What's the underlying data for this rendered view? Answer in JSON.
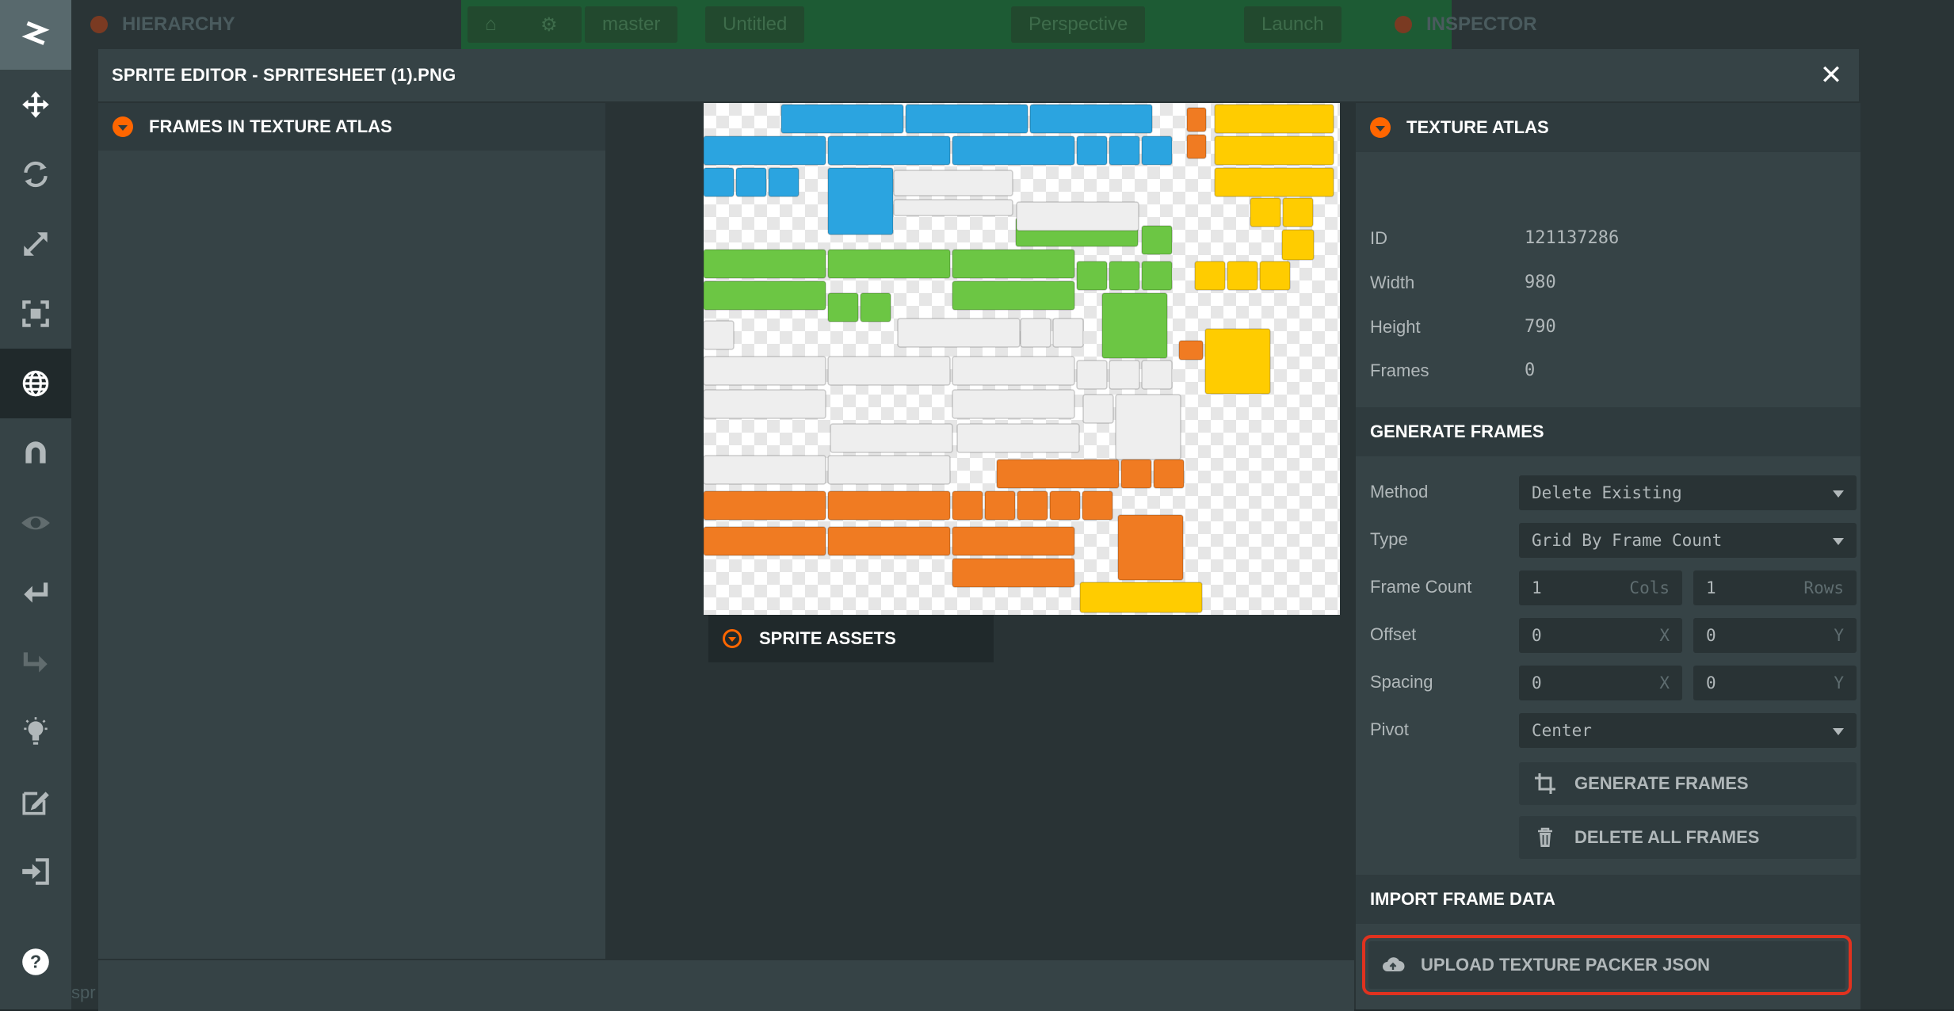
{
  "background": {
    "hierarchy_title": "HIERARCHY",
    "branch": "master",
    "scene": "Untitled",
    "perspective": "Perspective",
    "launch": "Launch",
    "inspector_title": "INSPECTOR",
    "bottom_text": "spr"
  },
  "modal": {
    "title": "SPRITE EDITOR - SPRITESHEET (1).PNG",
    "close_glyph": "✕"
  },
  "frames_panel": {
    "title": "FRAMES IN TEXTURE ATLAS"
  },
  "sprite_assets": {
    "title": "SPRITE ASSETS"
  },
  "texture_atlas": {
    "title": "TEXTURE ATLAS",
    "rows": [
      {
        "label": "ID",
        "value": "121137286"
      },
      {
        "label": "Width",
        "value": "980"
      },
      {
        "label": "Height",
        "value": "790"
      },
      {
        "label": "Frames",
        "value": "0"
      }
    ]
  },
  "generate_frames": {
    "title": "GENERATE FRAMES",
    "method_label": "Method",
    "method_value": "Delete Existing",
    "type_label": "Type",
    "type_value": "Grid By Frame Count",
    "frame_count_label": "Frame Count",
    "cols_value": "1",
    "cols_suffix": "Cols",
    "rows_value": "1",
    "rows_suffix": "Rows",
    "offset_label": "Offset",
    "offset_x": "0",
    "offset_y": "0",
    "spacing_label": "Spacing",
    "spacing_x": "0",
    "spacing_y": "0",
    "x_suffix": "X",
    "y_suffix": "Y",
    "pivot_label": "Pivot",
    "pivot_value": "Center",
    "generate_button": "GENERATE FRAMES",
    "delete_button": "DELETE ALL FRAMES"
  },
  "import_frame_data": {
    "title": "IMPORT FRAME DATA",
    "upload_button": "UPLOAD TEXTURE PACKER JSON"
  },
  "colors": {
    "accent": "#ff6600",
    "panel": "#364346",
    "dark": "#293335",
    "highlight": "#e0321f",
    "sprite_blue": "#2ba4e0",
    "sprite_green": "#6cc644",
    "sprite_orange": "#f07b22",
    "sprite_yellow": "#ffcc00",
    "sprite_white": "#eeeeee"
  },
  "toolbar": {
    "icons": [
      "playcanvas-logo-icon",
      "move-icon",
      "rotate-icon",
      "scale-icon",
      "resize-icon",
      "world-icon",
      "magnet-icon",
      "eye-icon",
      "undo-icon",
      "redo-icon",
      "lightbulb-icon",
      "code-editor-icon",
      "publish-icon",
      "help-icon"
    ]
  }
}
